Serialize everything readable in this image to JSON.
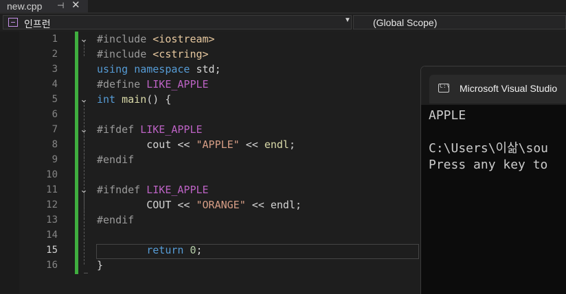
{
  "tab": {
    "filename": "new.cpp",
    "pin_glyph": "⊣",
    "close_glyph": "✕"
  },
  "navbar": {
    "project": "인프런",
    "scope": "(Global Scope)"
  },
  "line_numbers": [
    "1",
    "2",
    "3",
    "4",
    "5",
    "6",
    "7",
    "8",
    "9",
    "10",
    "11",
    "12",
    "13",
    "14",
    "15",
    "16"
  ],
  "code": {
    "l1": {
      "a": "#include ",
      "b": "<iostream>"
    },
    "l2": {
      "a": "#include ",
      "b": "<cstring>"
    },
    "l3": {
      "a": "using",
      "b": " ",
      "c": "namespace",
      "d": " std;"
    },
    "l4": {
      "a": "#define ",
      "b": "LIKE_APPLE"
    },
    "l5": {
      "a": "int",
      "b": " ",
      "c": "main",
      "d": "() {"
    },
    "l7": {
      "a": "#ifdef ",
      "b": "LIKE_APPLE"
    },
    "l8": {
      "a": "        cout ",
      "b": "<<",
      "c": " ",
      "d": "\"APPLE\"",
      "e": " << ",
      "f": "endl",
      "g": ";"
    },
    "l9": {
      "a": "#endif"
    },
    "l11": {
      "a": "#ifndef ",
      "b": "LIKE_APPLE"
    },
    "l12": {
      "a": "        COUT ",
      "b": "<<",
      "c": " ",
      "d": "\"ORANGE\"",
      "e": " << ",
      "f": "endl",
      "g": ";"
    },
    "l13": {
      "a": "#endif"
    },
    "l15": {
      "a": "        ",
      "b": "return",
      "c": " ",
      "d": "0",
      "e": ";"
    },
    "l16": {
      "a": "}"
    }
  },
  "console": {
    "title": "Microsoft Visual Studio",
    "line1": "APPLE",
    "line2": "",
    "line3": "C:\\Users\\이삶\\sou",
    "line4": "Press any key to"
  },
  "colors": {
    "accent_green": "#3fae3f",
    "keyword": "#569cd6",
    "macro": "#bd63c5",
    "string": "#d69d85"
  }
}
